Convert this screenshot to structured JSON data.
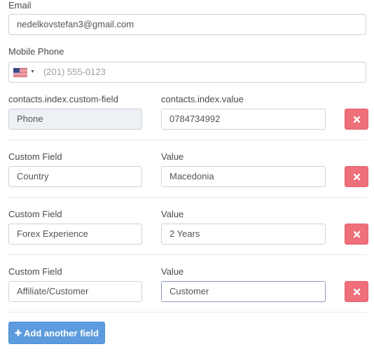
{
  "email": {
    "label": "Email",
    "value": "nedelkovstefan3@gmail.com"
  },
  "mobile_phone": {
    "label": "Mobile Phone",
    "placeholder": "(201) 555-0123",
    "country_flag_icon": "us-flag-icon"
  },
  "fields": [
    {
      "field_label": "contacts.index.custom-field",
      "value_label": "contacts.index.value",
      "field": "Phone",
      "value": "0784734992"
    },
    {
      "field_label": "Custom Field",
      "value_label": "Value",
      "field": "Country",
      "value": "Macedonia"
    },
    {
      "field_label": "Custom Field",
      "value_label": "Value",
      "field": "Forex Experience",
      "value": "2 Years"
    },
    {
      "field_label": "Custom Field",
      "value_label": "Value",
      "field": "Affiliate/Customer",
      "value": "Customer"
    }
  ],
  "add_button": {
    "label": "Add another field"
  },
  "colors": {
    "delete": "#ef6f7a",
    "primary": "#5b9bde"
  }
}
